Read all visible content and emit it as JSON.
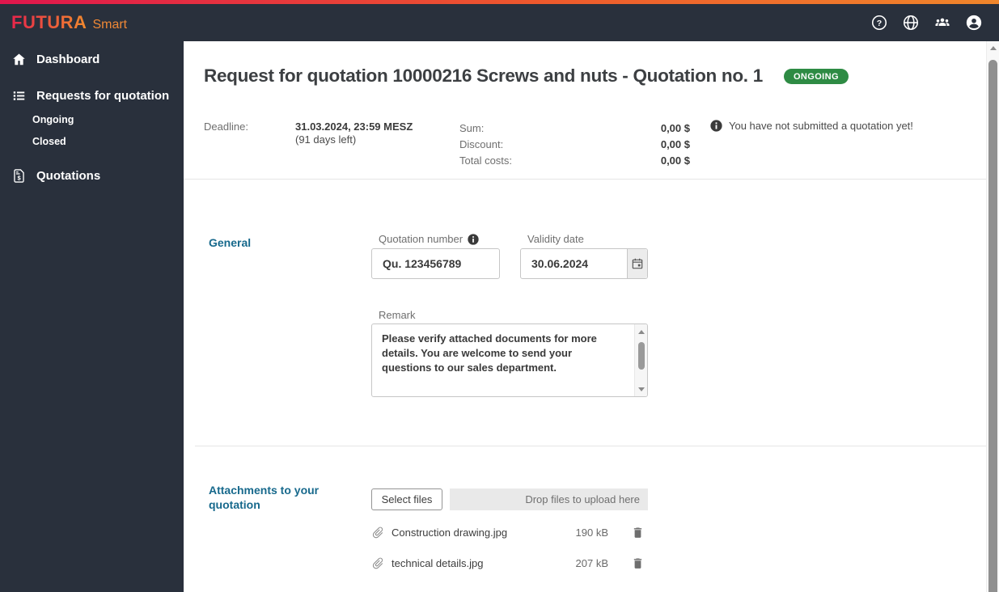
{
  "brand": {
    "name": "FUTURA",
    "suffix": "Smart"
  },
  "header": {
    "icons": [
      "help-icon",
      "language-globe-icon",
      "users-group-icon",
      "account-icon"
    ]
  },
  "sidebar": {
    "items": [
      {
        "label": "Dashboard",
        "icon": "home-icon"
      },
      {
        "label": "Requests for quotation",
        "icon": "list-icon",
        "children": [
          {
            "label": "Ongoing"
          },
          {
            "label": "Closed"
          }
        ]
      },
      {
        "label": "Quotations",
        "icon": "quote-document-icon"
      }
    ]
  },
  "page": {
    "title": "Request for quotation 10000216 Screws and nuts - Quotation no. 1",
    "status_badge": "ONGOING",
    "summary": {
      "deadline_label": "Deadline:",
      "deadline_value": "31.03.2024, 23:59 MESZ",
      "deadline_remaining": "(91 days left)",
      "rows": [
        {
          "label": "Sum:",
          "value": "0,00 $"
        },
        {
          "label": "Discount:",
          "value": "0,00 $"
        },
        {
          "label": "Total costs:",
          "value": "0,00 $"
        }
      ],
      "info_message": "You have not submitted a quotation yet!"
    },
    "general": {
      "section_title": "General",
      "quotation_number": {
        "label": "Quotation number",
        "value": "Qu. 123456789"
      },
      "validity_date": {
        "label": "Validity date",
        "value": "30.06.2024"
      },
      "remark": {
        "label": "Remark",
        "value": "Please verify attached documents for more details. You are welcome to send your questions to our sales department."
      }
    },
    "attachments": {
      "section_title": "Attachments to your quotation",
      "select_files_label": "Select files",
      "dropzone_label": "Drop files to upload here",
      "files": [
        {
          "name": "Construction drawing.jpg",
          "size": "190 kB"
        },
        {
          "name": "technical details.jpg",
          "size": "207 kB"
        }
      ]
    }
  },
  "colors": {
    "header_bg": "#29303c",
    "accent_gradient_start": "#e0164d",
    "accent_gradient_end": "#f0862b",
    "section_title": "#17698c",
    "status_badge_bg": "#2e8b44"
  }
}
